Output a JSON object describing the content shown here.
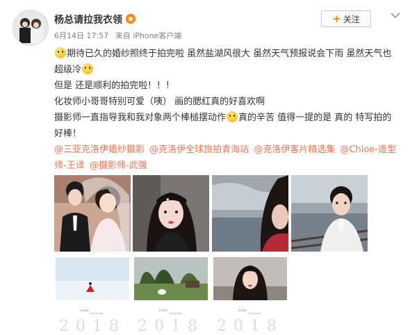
{
  "user": {
    "name": "杨总请拉我衣领",
    "timestamp": "6月14日 17:57",
    "source": "来自 iPhone客户端"
  },
  "actions": {
    "follow_label": "关注"
  },
  "post": {
    "line1": "期待已久的婚纱照终于拍完啦 虽然盐湖风很大  虽然天气预报说会下雨 虽然天气也超级冷",
    "line2": "但是 还是顺利的拍完啦！！！",
    "line3": "化妆师小哥哥特别可爱（咦） 画的腮红真的好喜欢啊",
    "line4a": "摄影师一直指导我和我对象两个棒槌摆动作",
    "line4b": "真的辛苦 值得一提的是 真的 特写拍的好棒！",
    "mentions": [
      "@三亚克洛伊婚纱摄影",
      "@克洛伊全球旅拍青海站",
      "@克洛伊客片精选集",
      "@Chloe-造型师-王译",
      "@摄影师-武强"
    ]
  },
  "photos": {
    "year_text": "2018"
  },
  "colors": {
    "accent": "#ff8200",
    "mention": "#eb7350",
    "text": "#333333",
    "meta": "#808080"
  },
  "icons": [
    "vip-star-icon",
    "plus-icon",
    "chevron-down-icon",
    "emoji-icon"
  ]
}
